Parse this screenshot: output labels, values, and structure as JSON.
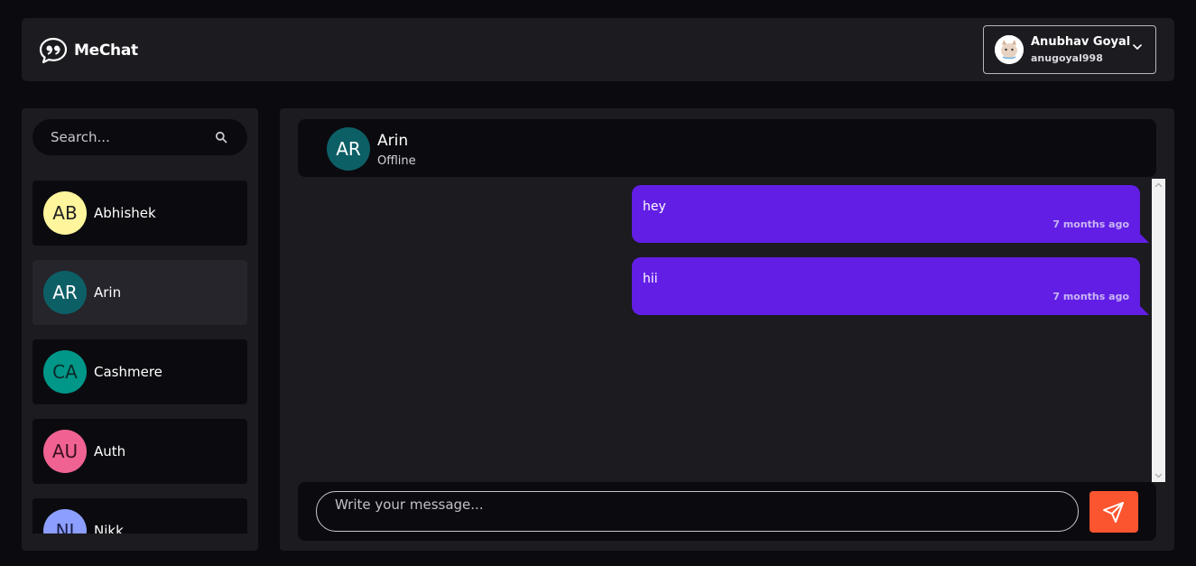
{
  "brand": {
    "name": "MeChat",
    "icon": "quote-chat-icon"
  },
  "user": {
    "name": "Anubhav Goyal",
    "handle": "anugoyal998",
    "avatar": "user-avatar-image"
  },
  "search": {
    "placeholder": "Search...",
    "icon": "search-icon"
  },
  "contacts": [
    {
      "initials": "AB",
      "name": "Abhishek",
      "color": "#fff59d",
      "text_color": "#222222",
      "active": false
    },
    {
      "initials": "AR",
      "name": "Arin",
      "color": "#0d5f66",
      "text_color": "#ffffff",
      "active": true
    },
    {
      "initials": "CA",
      "name": "Cashmere",
      "color": "#009688",
      "text_color": "#0b2a27",
      "active": false
    },
    {
      "initials": "AU",
      "name": "Auth",
      "color": "#f06292",
      "text_color": "#3a1020",
      "active": false
    },
    {
      "initials": "NI",
      "name": "Nikk",
      "color": "#8c9eff",
      "text_color": "#1a1f4a",
      "active": false
    }
  ],
  "chat": {
    "avatar_initials": "AR",
    "name": "Arin",
    "status": "Offline",
    "messages": [
      {
        "text": "hey",
        "time": "7 months ago"
      },
      {
        "text": "hii",
        "time": "7 months ago"
      }
    ]
  },
  "composer": {
    "placeholder": "Write your message...",
    "send_icon": "send-icon"
  },
  "colors": {
    "accent": "#631ee6",
    "send": "#fb5530",
    "panel": "#1b1b20",
    "background": "#0b0b0f"
  }
}
